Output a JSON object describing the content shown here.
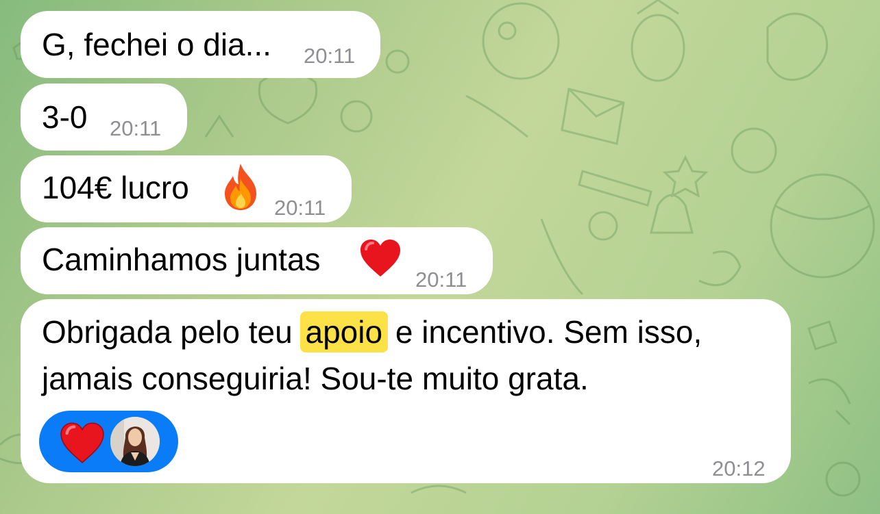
{
  "messages": [
    {
      "text": "G, fechei o dia...",
      "time": "20:11"
    },
    {
      "text": "3-0",
      "time": "20:11"
    },
    {
      "text": "104€ lucro",
      "emoji": "🔥",
      "emoji_icon": "fire-emoji",
      "time": "20:11"
    },
    {
      "text": "Caminhamos juntas",
      "emoji": "❤️",
      "emoji_icon": "red-heart-emoji",
      "time": "20:11"
    },
    {
      "line1_before": "Obrigada pelo teu ",
      "line1_highlight": "apoio",
      "line1_after": " e incentivo. Sem isso,",
      "line2": "jamais conseguiria! Sou-te muito grata.",
      "time": "20:12",
      "reaction": {
        "icon": "red-heart-icon",
        "reactor": "user-avatar"
      }
    }
  ],
  "colors": {
    "bubble": "#ffffff",
    "timestamp": "#8e8e93",
    "highlight": "#fde247",
    "reaction_pill": "#0a7cf7",
    "heart": "#e8141e"
  }
}
